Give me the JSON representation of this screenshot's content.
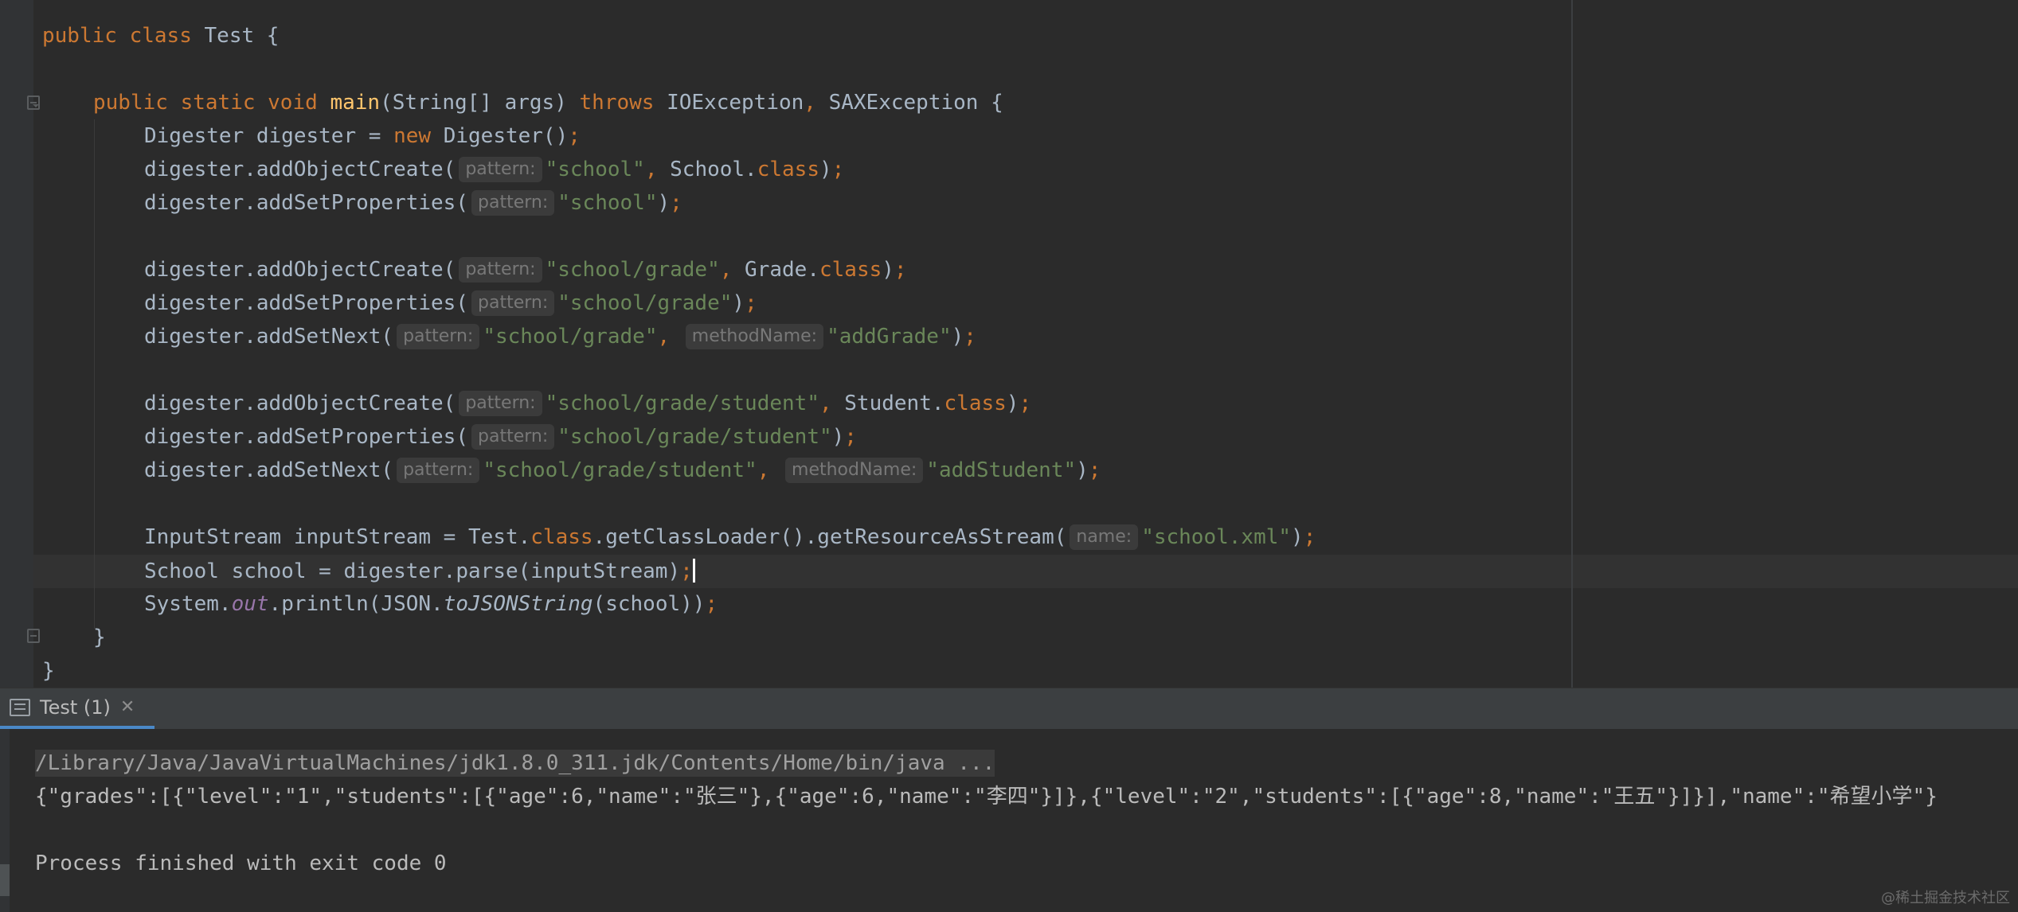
{
  "editor": {
    "lines": {
      "l1": {
        "kw1": "public",
        "kw2": "class",
        "name": "Test",
        "rest": " {"
      },
      "l3": {
        "kw1": "public",
        "kw2": "static",
        "kw3": "void",
        "method": "main",
        "sig": "(String[] args) ",
        "kw4": "throws",
        "ex1": " IOException",
        "comma": ",",
        "ex2": " SAXException {"
      },
      "l4": {
        "a": "Digester digester = ",
        "kw": "new",
        "b": " Digester()",
        "semi": ";"
      },
      "l5": {
        "call": "digester.addObjectCreate(",
        "hint": "pattern:",
        "str": "\"school\"",
        "comma": ",",
        "mid": " School.",
        "kw": "class",
        "close": ")",
        "semi": ";"
      },
      "l6": {
        "call": "digester.addSetProperties(",
        "hint": "pattern:",
        "str": "\"school\"",
        "close": ")",
        "semi": ";"
      },
      "l8": {
        "call": "digester.addObjectCreate(",
        "hint": "pattern:",
        "str": "\"school/grade\"",
        "comma": ",",
        "mid": " Grade.",
        "kw": "class",
        "close": ")",
        "semi": ";"
      },
      "l9": {
        "call": "digester.addSetProperties(",
        "hint": "pattern:",
        "str": "\"school/grade\"",
        "close": ")",
        "semi": ";"
      },
      "l10": {
        "call": "digester.addSetNext(",
        "hint1": "pattern:",
        "str1": "\"school/grade\"",
        "comma": ",",
        "hint2": "methodName:",
        "str2": "\"addGrade\"",
        "close": ")",
        "semi": ";"
      },
      "l12": {
        "call": "digester.addObjectCreate(",
        "hint": "pattern:",
        "str": "\"school/grade/student\"",
        "comma": ",",
        "mid": " Student.",
        "kw": "class",
        "close": ")",
        "semi": ";"
      },
      "l13": {
        "call": "digester.addSetProperties(",
        "hint": "pattern:",
        "str": "\"school/grade/student\"",
        "close": ")",
        "semi": ";"
      },
      "l14": {
        "call": "digester.addSetNext(",
        "hint1": "pattern:",
        "str1": "\"school/grade/student\"",
        "comma": ",",
        "hint2": "methodName:",
        "str2": "\"addStudent\"",
        "close": ")",
        "semi": ";"
      },
      "l16": {
        "a": "InputStream inputStream = Test.",
        "kw": "class",
        "b": ".getClassLoader().getResourceAsStream(",
        "hint": "name:",
        "str": "\"school.xml\"",
        "close": ")",
        "semi": ";"
      },
      "l17": {
        "a": "School school = digester.parse(inputStream)",
        "semi": ";"
      },
      "l18": {
        "a": "System.",
        "field": "out",
        "b": ".println(JSON.",
        "method": "toJSONString",
        "c": "(school))",
        "semi": ";"
      },
      "l19": {
        "text": "}"
      },
      "l20": {
        "text": "}"
      }
    }
  },
  "run_panel": {
    "tab_label": "Test (1)",
    "tab_close": "✕",
    "console_lines": [
      "/Library/Java/JavaVirtualMachines/jdk1.8.0_311.jdk/Contents/Home/bin/java ...",
      "{\"grades\":[{\"level\":\"1\",\"students\":[{\"age\":6,\"name\":\"张三\"},{\"age\":6,\"name\":\"李四\"}]},{\"level\":\"2\",\"students\":[{\"age\":8,\"name\":\"王五\"}]}],\"name\":\"希望小学\"}",
      "Process finished with exit code 0"
    ]
  },
  "watermark": "@稀土掘金技术社区",
  "colors": {
    "background": "#2b2b2b",
    "keyword": "#cc7832",
    "string": "#6a8759",
    "method_decl": "#ffc66d",
    "static_field": "#9876aa",
    "default_text": "#a9b7c6"
  }
}
